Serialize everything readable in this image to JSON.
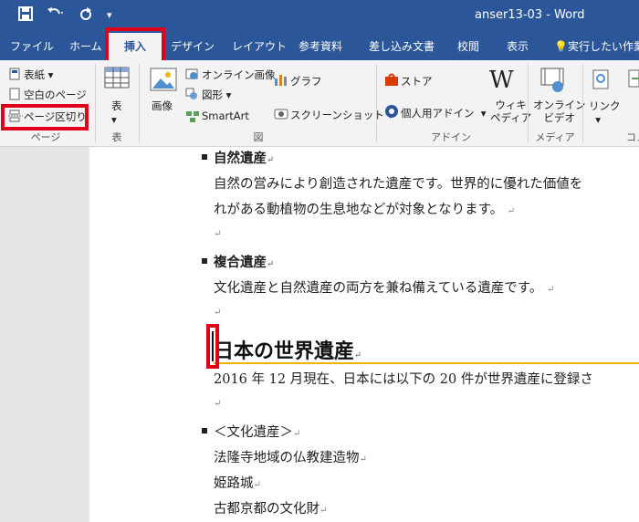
{
  "titlebar": {
    "doc_title": "anser13-03  -  Word",
    "save_icon": "save-icon",
    "undo_icon": "undo-icon",
    "redo_icon": "repeat-icon",
    "qat_more": "▾",
    "bg": "#2b579a"
  },
  "tabs": [
    {
      "label": "ファイル"
    },
    {
      "label": "ホーム"
    },
    {
      "label": "挿入",
      "active": true
    },
    {
      "label": "デザイン"
    },
    {
      "label": "レイアウト"
    },
    {
      "label": "参考資料"
    },
    {
      "label": "差し込み文書"
    },
    {
      "label": "校閲"
    },
    {
      "label": "表示"
    },
    {
      "label": "実行したい作業"
    }
  ],
  "ribbon": {
    "page_group": {
      "label": "ページ",
      "cover": "表紙",
      "blank": "空白のページ",
      "page_break": "ページ区切り"
    },
    "table_group": {
      "label": "表",
      "table": "表"
    },
    "illustration_group": {
      "label": "図",
      "picture": "画像",
      "online_picture": "オンライン画像",
      "shapes": "図形",
      "smartart": "SmartArt",
      "chart": "グラフ",
      "screenshot": "スクリーンショット"
    },
    "addin_group": {
      "label": "アドイン",
      "store": "ストア",
      "my_addins": "個人用アドイン",
      "wiki_line1": "ウィキ",
      "wiki_line2": "ペディア",
      "wiki_glyph": "W"
    },
    "media_group": {
      "label": "メディア",
      "online_video_line1": "オンライン",
      "online_video_line2": "ビデオ"
    },
    "links_group": {
      "link": "リンク",
      "label_cut": "コメ"
    }
  },
  "document": {
    "item1_title": "自然遺産",
    "item1_line1": "自然の営みにより創造された遺産です。世界的に優れた価値を",
    "item1_line2": "れがある動植物の生息地などが対象となります。",
    "item2_title": "複合遺産",
    "item2_line1": "文化遺産と自然遺産の両方を兼ね備えている遺産です。",
    "heading": "日本の世界遺産",
    "body1": "2016 年 12 月現在、日本には以下の 20 件が世界遺産に登録さ",
    "list_title": "＜文化遺産＞",
    "list1": "法隆寺地域の仏教建造物",
    "list2": "姫路城",
    "list3": "古都京都の文化財",
    "para_mark": "↵",
    "para_mark2": "↵"
  },
  "colors": {
    "accent": "#2b579a",
    "highlight": "#e0001a",
    "heading_rule": "#f0b400"
  }
}
